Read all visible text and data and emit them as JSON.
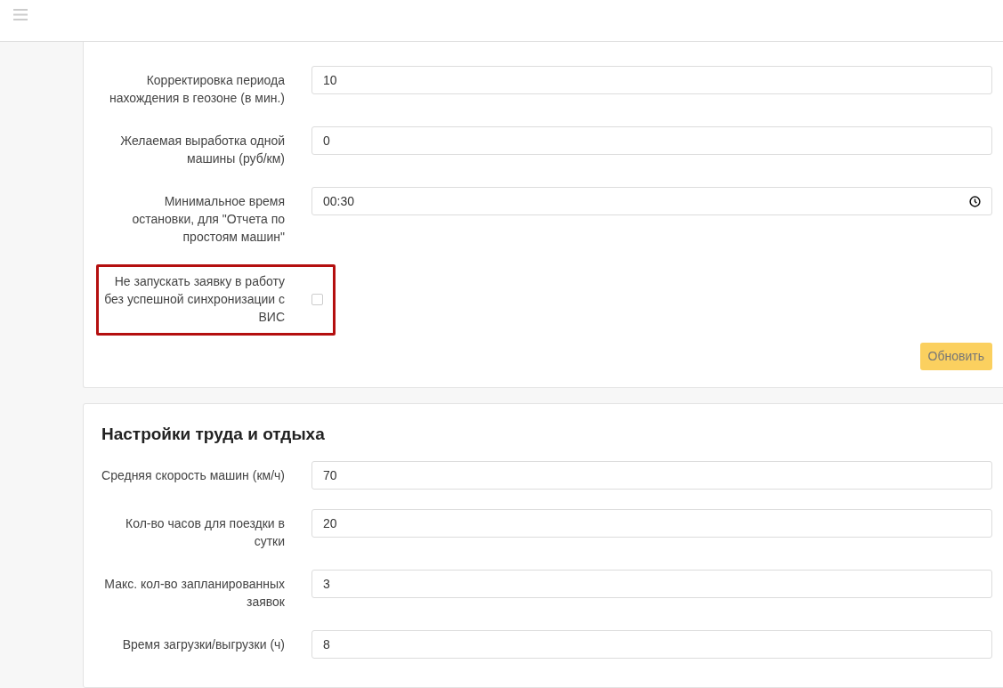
{
  "cards": [
    {
      "rows": [
        {
          "kind": "number",
          "label": "Корректировка периода нахождения в геозоне (в мин.)",
          "value": "10"
        },
        {
          "kind": "number",
          "label": "Желаемая выработка одной машины (руб/км)",
          "value": "0"
        },
        {
          "kind": "time",
          "label": "Минимальное время остановки, для \"Отчета по простоям машин\"",
          "value": "00:30"
        },
        {
          "kind": "checkbox",
          "label": "Не запускать заявку в работу без успешной синхронизации с ВИС",
          "checked": false,
          "highlighted": true
        }
      ],
      "button": {
        "label": "Обновить",
        "disabled": true
      }
    },
    {
      "title": "Настройки труда и отдыха",
      "rows": [
        {
          "kind": "number",
          "label": "Средняя скорость машин (км/ч)",
          "value": "70"
        },
        {
          "kind": "number",
          "label": "Кол-во часов для поездки в сутки",
          "value": "20"
        },
        {
          "kind": "number",
          "label": "Макс. кол-во запланированных заявок",
          "value": "3"
        },
        {
          "kind": "number",
          "label": "Время загрузки/выгрузки (ч)",
          "value": "8"
        }
      ]
    }
  ]
}
